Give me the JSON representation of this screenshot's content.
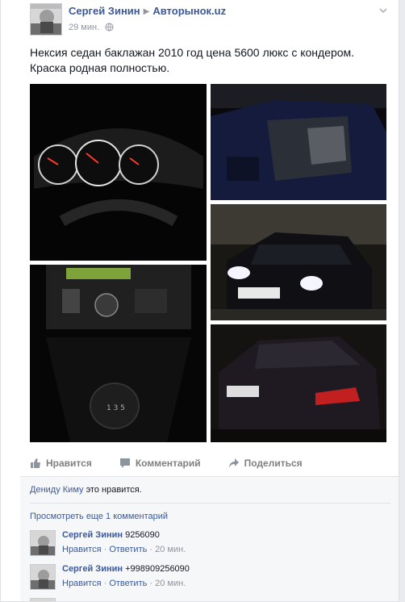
{
  "post": {
    "author": "Сергей Зинин",
    "group": "Авторынок.uz",
    "time": "29 мин.",
    "text": "Нексия седан баклажан 2010 год цена 5600 люкс с кондером. Краска родная полностью.",
    "photos": [
      {
        "subject": "dashboard-gauges"
      },
      {
        "subject": "car-interior-open-door"
      },
      {
        "subject": "car-front-night"
      },
      {
        "subject": "center-console-gear-shift"
      },
      {
        "subject": "car-rear-night"
      }
    ]
  },
  "actions": {
    "like": "Нравится",
    "comment": "Комментарий",
    "share": "Поделиться"
  },
  "likes": {
    "liker": "Дениду Киму",
    "suffix": "это нравится."
  },
  "view_more": "Просмотреть еще 1 комментарий",
  "comments": [
    {
      "author": "Сергей Зинин",
      "text": "9256090",
      "like": "Нравится",
      "reply": "Ответить",
      "time": "20 мин."
    },
    {
      "author": "Сергей Зинин",
      "text": "+998909256090",
      "like": "Нравится",
      "reply": "Ответить",
      "time": "20 мин."
    }
  ],
  "colors": {
    "link": "#3b5998",
    "muted": "#90949c",
    "background": "#e9ebee"
  },
  "icons": [
    "chevron-down-icon",
    "arrow-icon",
    "globe-icon",
    "like-icon",
    "comment-icon",
    "share-icon"
  ]
}
